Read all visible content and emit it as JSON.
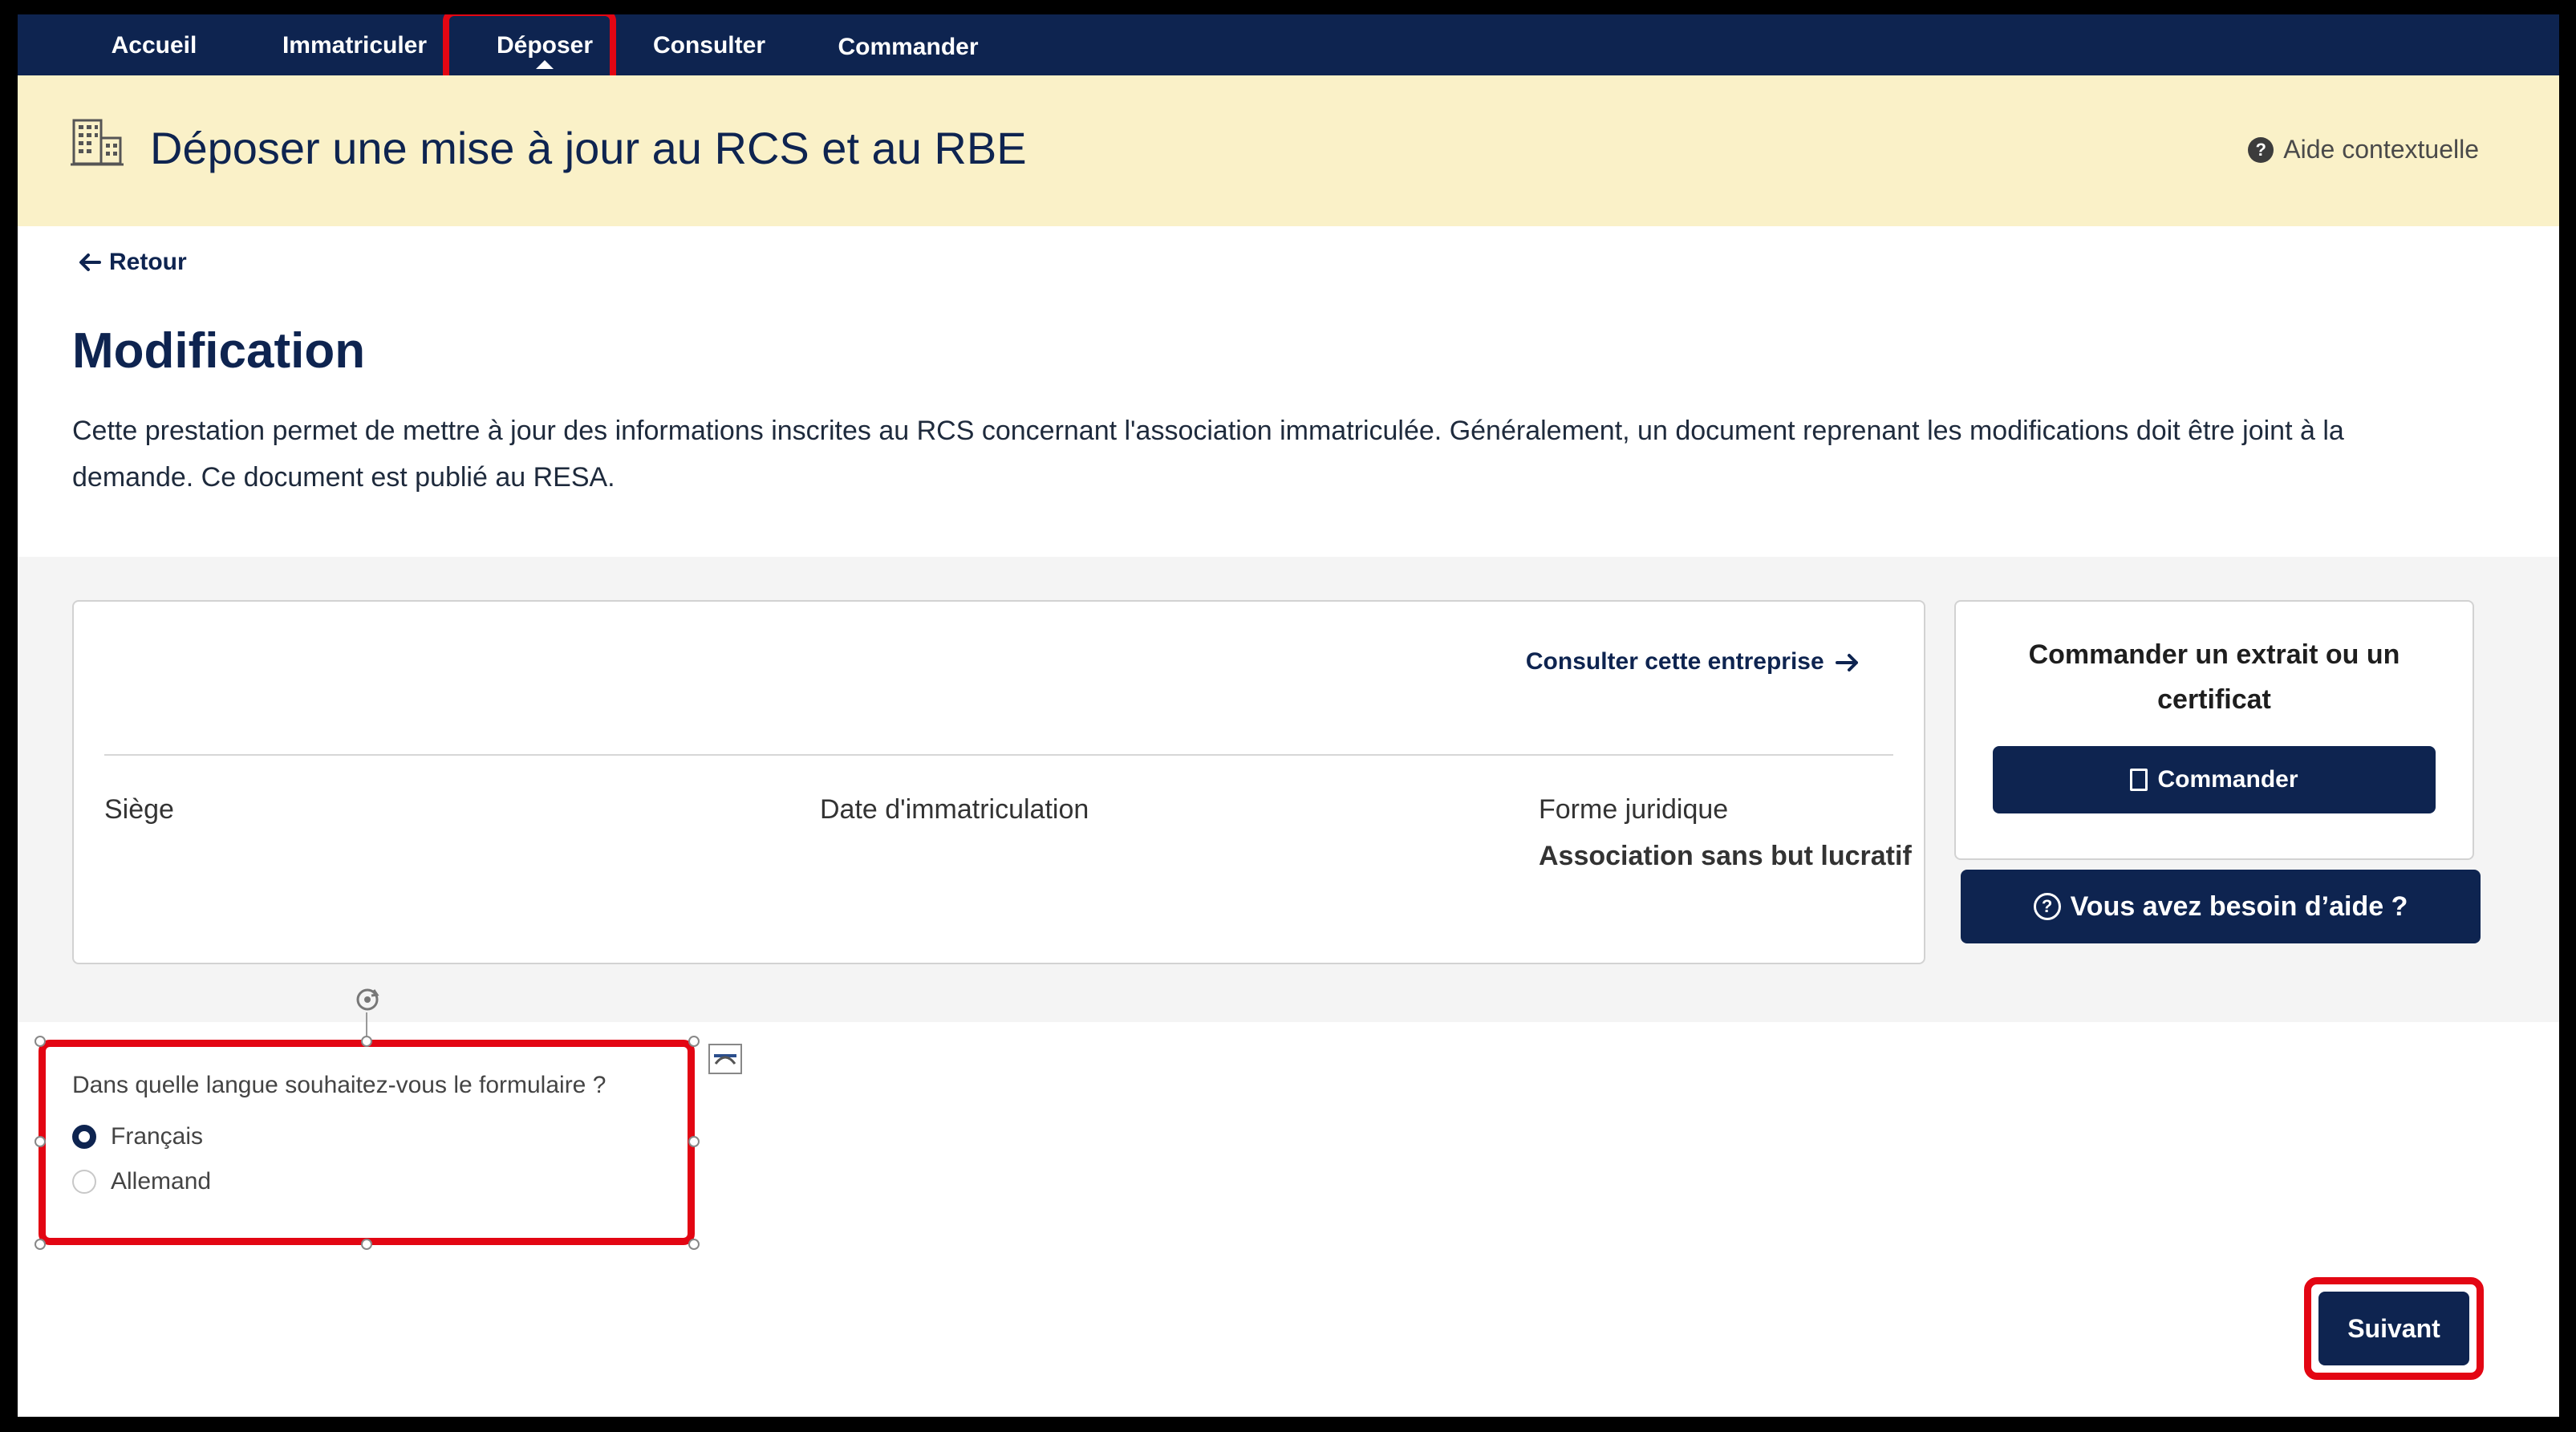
{
  "nav": {
    "items": [
      "Accueil",
      "Immatriculer",
      "Déposer",
      "Consulter",
      "Commander"
    ],
    "active": "Déposer"
  },
  "header": {
    "title": "Déposer une mise à jour au RCS et au RBE",
    "help_label": "Aide contextuelle",
    "help_icon": "question-circle-icon",
    "page_icon": "building-icon"
  },
  "back": {
    "label": "Retour",
    "icon": "arrow-left-icon"
  },
  "page": {
    "title": "Modification",
    "description": "Cette prestation permet de mettre à jour des informations inscrites au RCS concernant l'association immatriculée. Généralement, un document reprenant les modifications doit être joint à la demande. Ce document est publié au RESA."
  },
  "entreprise": {
    "consult_link": "Consulter cette entreprise",
    "fields": [
      {
        "label": "Siège",
        "value": ""
      },
      {
        "label": "Date d'immatriculation",
        "value": ""
      },
      {
        "label": "Forme juridique",
        "value": "Association sans but lucratif"
      }
    ]
  },
  "side": {
    "title": "Commander un extrait ou un certificat",
    "order_button": "Commander",
    "help_button": "Vous avez besoin d’aide ?"
  },
  "language": {
    "question": "Dans quelle langue souhaitez-vous le formulaire ?",
    "options": [
      "Français",
      "Allemand"
    ],
    "selected": "Français"
  },
  "footer": {
    "next_button": "Suivant"
  },
  "colors": {
    "navy": "#0e2450",
    "band": "#faf1c8",
    "highlight": "#e30613"
  }
}
